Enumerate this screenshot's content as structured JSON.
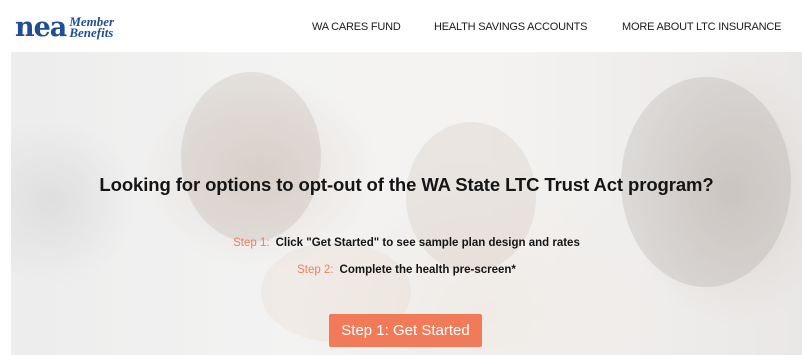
{
  "header": {
    "logo": {
      "nea_text": "nea",
      "member_text": "Member",
      "benefits_text": "Benefits"
    },
    "nav": [
      {
        "label": "WA CARES FUND"
      },
      {
        "label": "HEALTH SAVINGS ACCOUNTS"
      },
      {
        "label": "MORE ABOUT LTC INSURANCE"
      }
    ]
  },
  "hero": {
    "title": "Looking for options to opt-out of the WA State LTC Trust Act program?",
    "steps": [
      {
        "prefix": "Step 1:",
        "text": "Click \"Get Started\" to see sample plan design and rates"
      },
      {
        "prefix": "Step 2:",
        "text": "Complete the health pre-screen*"
      }
    ],
    "cta_label": "Step 1: Get Started"
  },
  "colors": {
    "brand_blue": "#1f4e96",
    "accent_orange": "#f17a59",
    "step_prefix": "#f07f5c"
  }
}
